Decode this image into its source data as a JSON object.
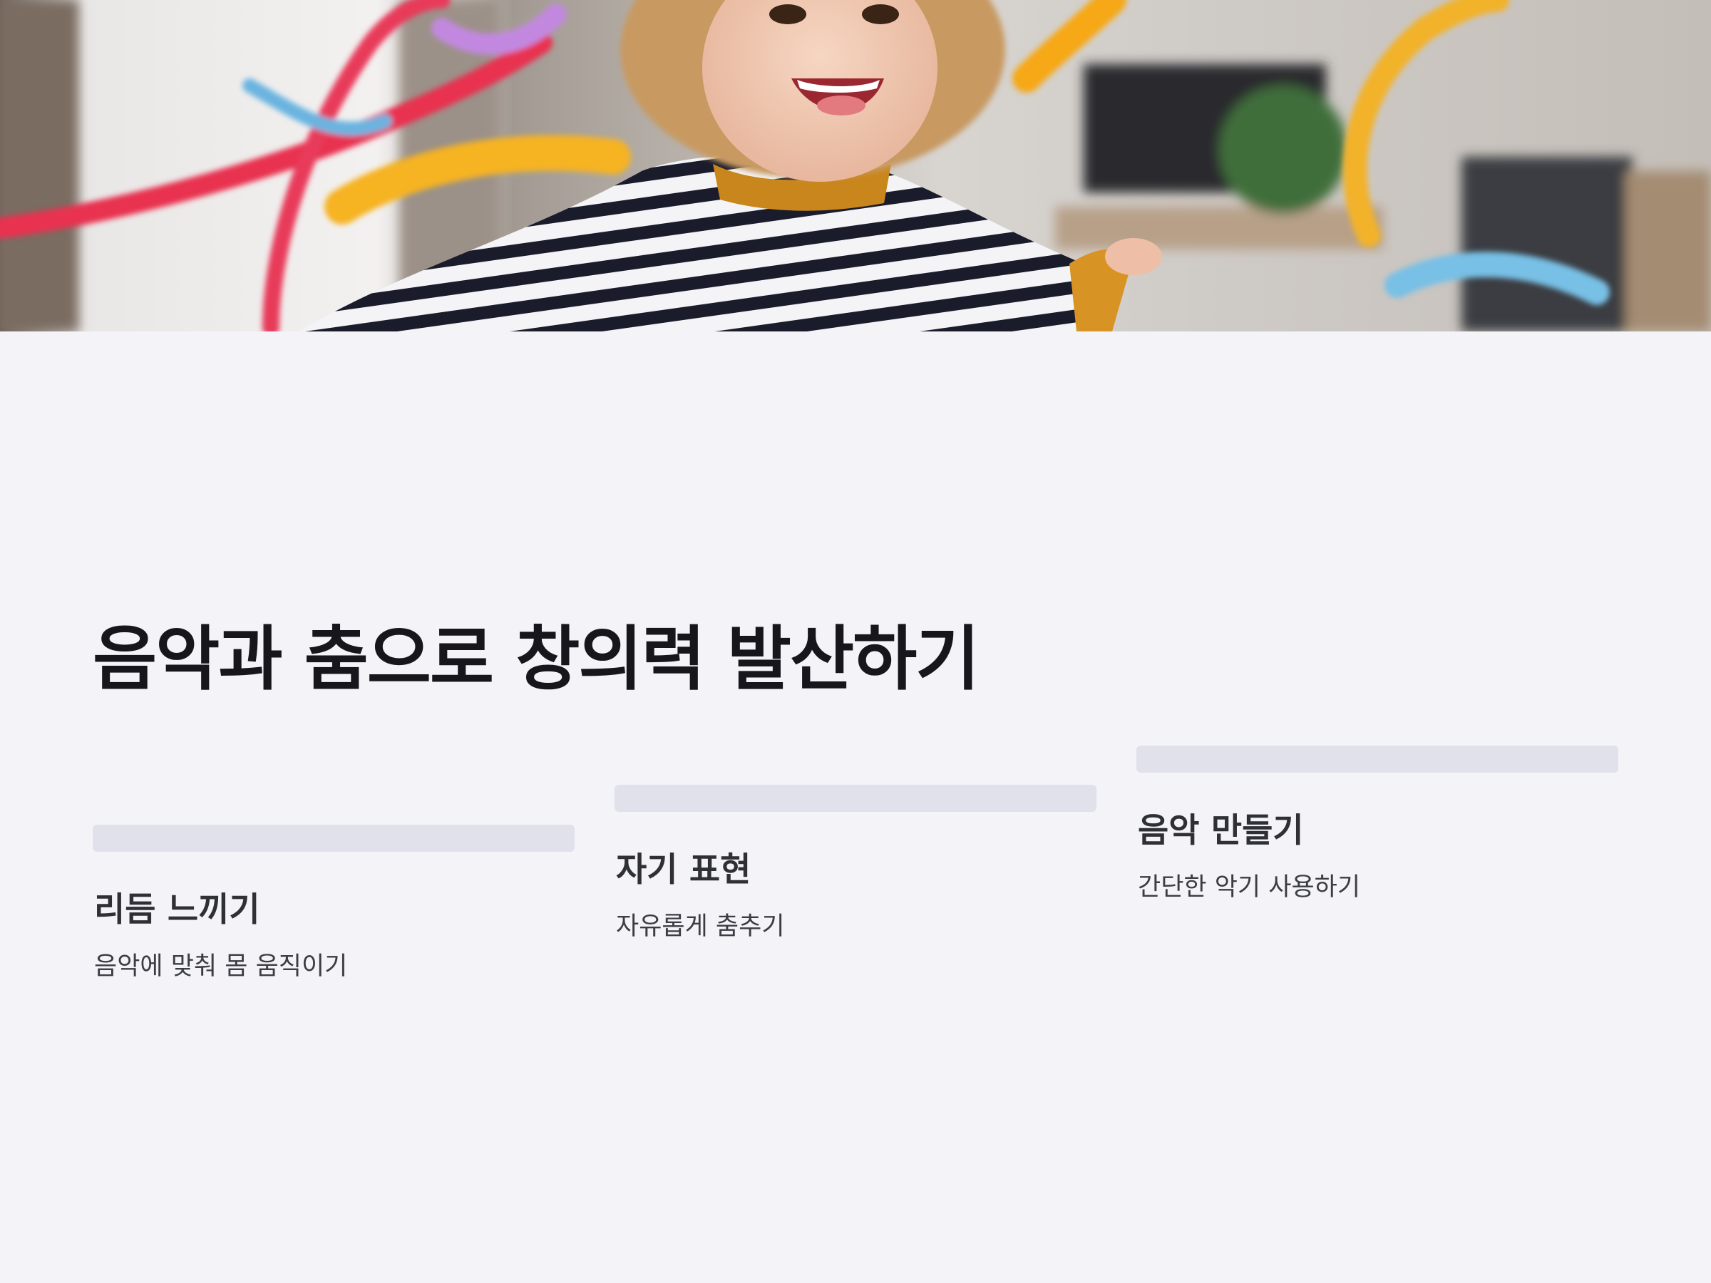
{
  "hero": {
    "image_description_icon": "child-dancing-with-ribbons-photo"
  },
  "title": "음악과 춤으로 창의력 발산하기",
  "cards": [
    {
      "title": "리듬 느끼기",
      "description": "음악에 맞춰 몸 움직이기"
    },
    {
      "title": "자기 표현",
      "description": "자유롭게 춤추기"
    },
    {
      "title": "음악 만들기",
      "description": "간단한 악기 사용하기"
    }
  ],
  "colors": {
    "background": "#f4f3f8",
    "card_bar": "#e1e1ec",
    "title": "#16161c",
    "card_title": "#2f2f36",
    "card_text": "#3c3c44"
  }
}
